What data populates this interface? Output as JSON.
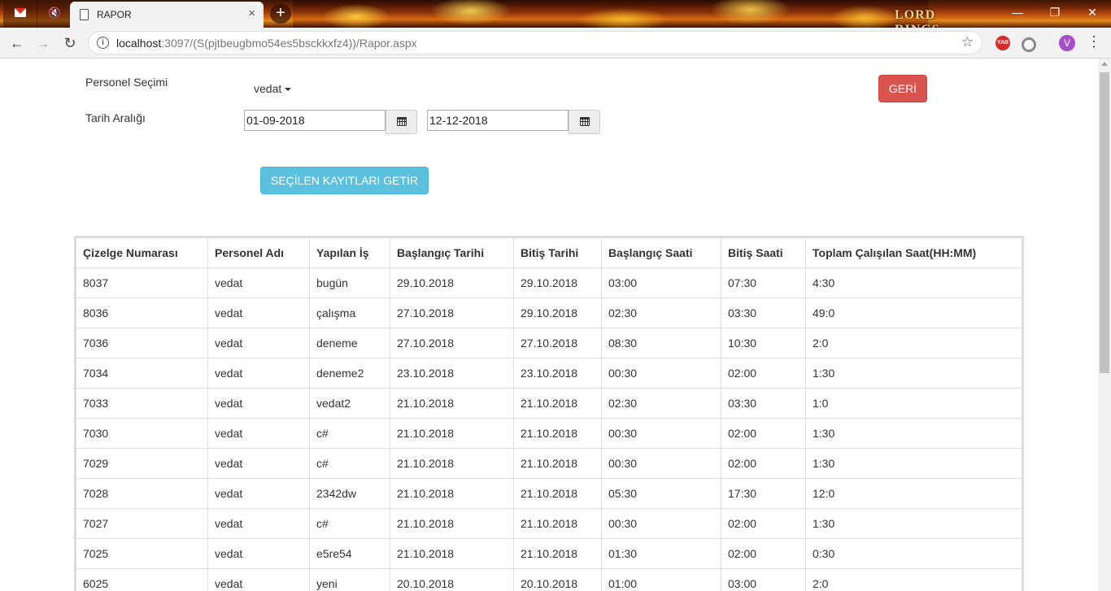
{
  "browser": {
    "tab_title": "RAPOR",
    "banner_text": "LORD RINGS",
    "url_host": "localhost",
    "url_rest": ":3097/(S(pjtbeugbmo54es5bsckkxfz4))/Rapor.aspx",
    "extension_label": "YAB",
    "avatar_letter": "V",
    "new_tab_symbol": "+",
    "close_symbol": "×",
    "win_min": "—",
    "win_max": "❐",
    "win_close": "✕"
  },
  "form": {
    "personel_label": "Personel Seçimi",
    "personel_selected": "vedat",
    "tarih_label": "Tarih Aralığı",
    "start_date": "01-09-2018",
    "end_date": "12-12-2018",
    "geri_button": "GERİ",
    "getir_button": "SEÇİLEN KAYITLARI GETİR"
  },
  "table": {
    "headers": [
      "Çizelge Numarası",
      "Personel Adı",
      "Yapılan İş",
      "Başlangıç Tarihi",
      "Bitiş Tarihi",
      "Başlangıç Saati",
      "Bitiş Saati",
      "Toplam Çalışılan Saat(HH:MM)"
    ],
    "rows": [
      [
        "8037",
        "vedat",
        "bugün",
        "29.10.2018",
        "29.10.2018",
        "03:00",
        "07:30",
        "4:30"
      ],
      [
        "8036",
        "vedat",
        "çalışma",
        "27.10.2018",
        "29.10.2018",
        "02:30",
        "03:30",
        "49:0"
      ],
      [
        "7036",
        "vedat",
        "deneme",
        "27.10.2018",
        "27.10.2018",
        "08:30",
        "10:30",
        "2:0"
      ],
      [
        "7034",
        "vedat",
        "deneme2",
        "23.10.2018",
        "23.10.2018",
        "00:30",
        "02:00",
        "1:30"
      ],
      [
        "7033",
        "vedat",
        "vedat2",
        "21.10.2018",
        "21.10.2018",
        "02:30",
        "03:30",
        "1:0"
      ],
      [
        "7030",
        "vedat",
        "c#",
        "21.10.2018",
        "21.10.2018",
        "00:30",
        "02:00",
        "1:30"
      ],
      [
        "7029",
        "vedat",
        "c#",
        "21.10.2018",
        "21.10.2018",
        "00:30",
        "02:00",
        "1:30"
      ],
      [
        "7028",
        "vedat",
        "2342dw",
        "21.10.2018",
        "21.10.2018",
        "05:30",
        "17:30",
        "12:0"
      ],
      [
        "7027",
        "vedat",
        "c#",
        "21.10.2018",
        "21.10.2018",
        "00:30",
        "02:00",
        "1:30"
      ],
      [
        "7025",
        "vedat",
        "e5re54",
        "21.10.2018",
        "21.10.2018",
        "01:30",
        "02:00",
        "0:30"
      ],
      [
        "6025",
        "vedat",
        "yeni",
        "20.10.2018",
        "20.10.2018",
        "01:00",
        "03:00",
        "2:0"
      ]
    ]
  }
}
